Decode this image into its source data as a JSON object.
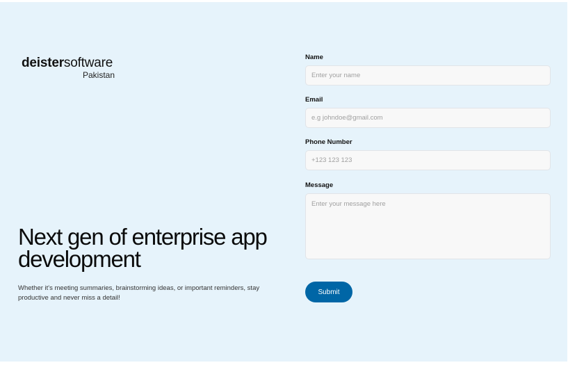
{
  "brand": {
    "name_bold": "deister",
    "name_light": "software",
    "region": "Pakistan"
  },
  "hero": {
    "title": "Next gen of enterprise app development",
    "subtitle": "Whether it's meeting summaries, brainstorming ideas, or important reminders, stay productive and never miss a detail!"
  },
  "form": {
    "name": {
      "label": "Name",
      "placeholder": "Enter your name"
    },
    "email": {
      "label": "Email",
      "placeholder": "e.g johndoe@gmail.com"
    },
    "phone": {
      "label": "Phone Number",
      "placeholder": "+123 123 123"
    },
    "message": {
      "label": "Message",
      "placeholder": "Enter your message here"
    },
    "submit_label": "Submit"
  },
  "colors": {
    "background": "#e6f3fb",
    "accent": "#0066a6",
    "field_background": "#f8f8f8"
  }
}
